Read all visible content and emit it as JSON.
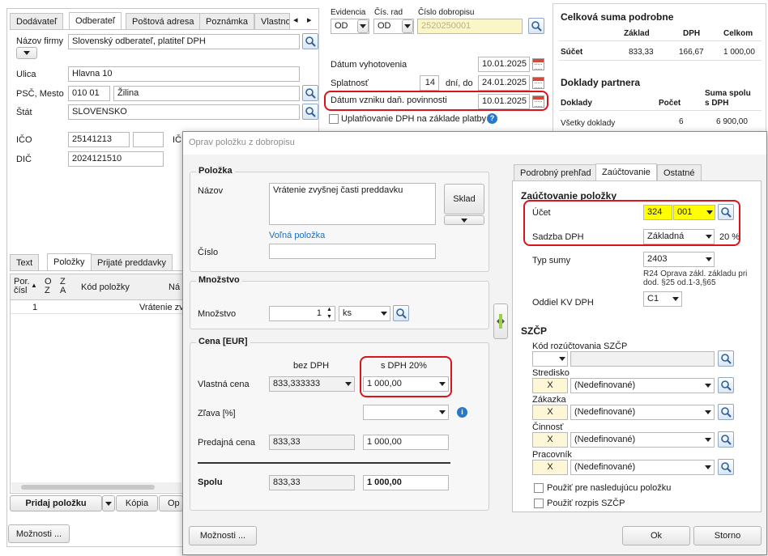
{
  "left": {
    "tabs": [
      "Dodávateľ",
      "Odberateľ",
      "Poštová adresa",
      "Poznámka",
      "Vlastno"
    ],
    "nazov_label": "Názov firmy",
    "nazov_value": "Slovenský odberateľ, platiteľ DPH",
    "ulica_label": "Ulica",
    "ulica_value": "Hlavna 10",
    "psc_label": "PSČ, Mesto",
    "psc_value": "010 01",
    "mesto_value": "Žilina",
    "stat_label": "Štát",
    "stat_value": "SLOVENSKO",
    "ico_label": "IČO",
    "ico_value": "25141213",
    "ic_label": "IČ",
    "dic_label": "DIČ",
    "dic_value": "2024121510",
    "bottom_tabs": [
      "Text",
      "Položky",
      "Prijaté preddavky"
    ],
    "grid_headers": [
      "Por. čísl",
      "O Z",
      "Z A",
      "Kód položky",
      "Ná"
    ],
    "grid_row": {
      "por": "1",
      "nazov": "Vrátenie zv"
    },
    "add_button": "Pridaj položku",
    "copy_button": "Kópia",
    "op_button": "Op",
    "options_button": "Možnosti ..."
  },
  "top": {
    "evidencia_label": "Evidencia",
    "evidencia_value": "OD",
    "cisrad_label": "Čís. rad",
    "cisrad_value": "OD",
    "cislo_label": "Číslo dobropisu",
    "cislo_value": "2520250001",
    "vyhotovenie_label": "Dátum vyhotovenia",
    "vyhotovenie_value": "10.01.2025",
    "splatnost_label": "Splatnosť",
    "splatnost_days": "14",
    "splatnost_mid": "dní, do",
    "splatnost_value": "24.01.2025",
    "vznik_label": "Dátum vzniku daň. povinnosti",
    "vznik_value": "10.01.2025",
    "uplat_label": "Uplatňovanie DPH na základe platby"
  },
  "summary": {
    "title": "Celková suma podrobne",
    "headers": [
      "Základ",
      "DPH",
      "Celkom"
    ],
    "row_label": "Súčet",
    "row_values": [
      "833,33",
      "166,67",
      "1 000,00"
    ],
    "partner_title": "Doklady partnera",
    "partner_headers": [
      "Doklady",
      "Počet",
      "Suma spolu s DPH"
    ],
    "partner_row": [
      "Všetky doklady",
      "6",
      "6 900,00"
    ]
  },
  "dialog": {
    "title": "Oprav položku z dobropisu",
    "polozka_group": "Položka",
    "nazov_label": "Názov",
    "nazov_value": "Vrátenie zvyšnej časti preddavku",
    "sklad_button": "Sklad",
    "volna_link": "Voľná položka",
    "cislo_label": "Číslo",
    "mnozstvo_group": "Množstvo",
    "mnozstvo_label": "Množstvo",
    "mnozstvo_value": "1",
    "jednotka_value": "ks",
    "cena_group": "Cena [EUR]",
    "bez_dph": "bez DPH",
    "s_dph": "s DPH 20%",
    "vlastna_label": "Vlastná cena",
    "vlastna_bez": "833,333333",
    "vlastna_s": "1 000,00",
    "zlava_label": "Zľava [%]",
    "predajna_label": "Predajná cena",
    "predajna_bez": "833,33",
    "predajna_s": "1 000,00",
    "spolu_label": "Spolu",
    "spolu_bez": "833,33",
    "spolu_s": "1 000,00",
    "options_button": "Možnosti ...",
    "tabs": [
      "Podrobný prehľad",
      "Zaúčtovanie",
      "Ostatné"
    ],
    "zauc_title": "Zaúčtovanie položky",
    "ucet_label": "Účet",
    "ucet_syn": "324",
    "ucet_anal": "001",
    "sadzba_label": "Sadzba DPH",
    "sadzba_value": "Základná",
    "sadzba_pct": "20 %",
    "typ_label": "Typ sumy",
    "typ_value": "2403",
    "typ_desc": "R24 Oprava zákl. základu pri dod. §25 od.1-3,§65",
    "oddiel_label": "Oddiel KV DPH",
    "oddiel_value": "C1",
    "szcp_title": "SZČP",
    "kod_label": "Kód rozúčtovania SZČP",
    "stredisko_label": "Stredisko",
    "zakazka_label": "Zákazka",
    "cinnost_label": "Činnosť",
    "pracovnik_label": "Pracovník",
    "x_value": "X",
    "nedef": "(Nedefinované)",
    "pouzit1": "Použiť pre nasledujúcu položku",
    "pouzit2": "Použiť rozpis SZČP",
    "ok_button": "Ok",
    "storno_button": "Storno"
  },
  "colors": {
    "highlight": "#ffff00",
    "readonly": "#f1f1f1",
    "link": "#1a6fc4",
    "annotation": "#d9151b"
  }
}
